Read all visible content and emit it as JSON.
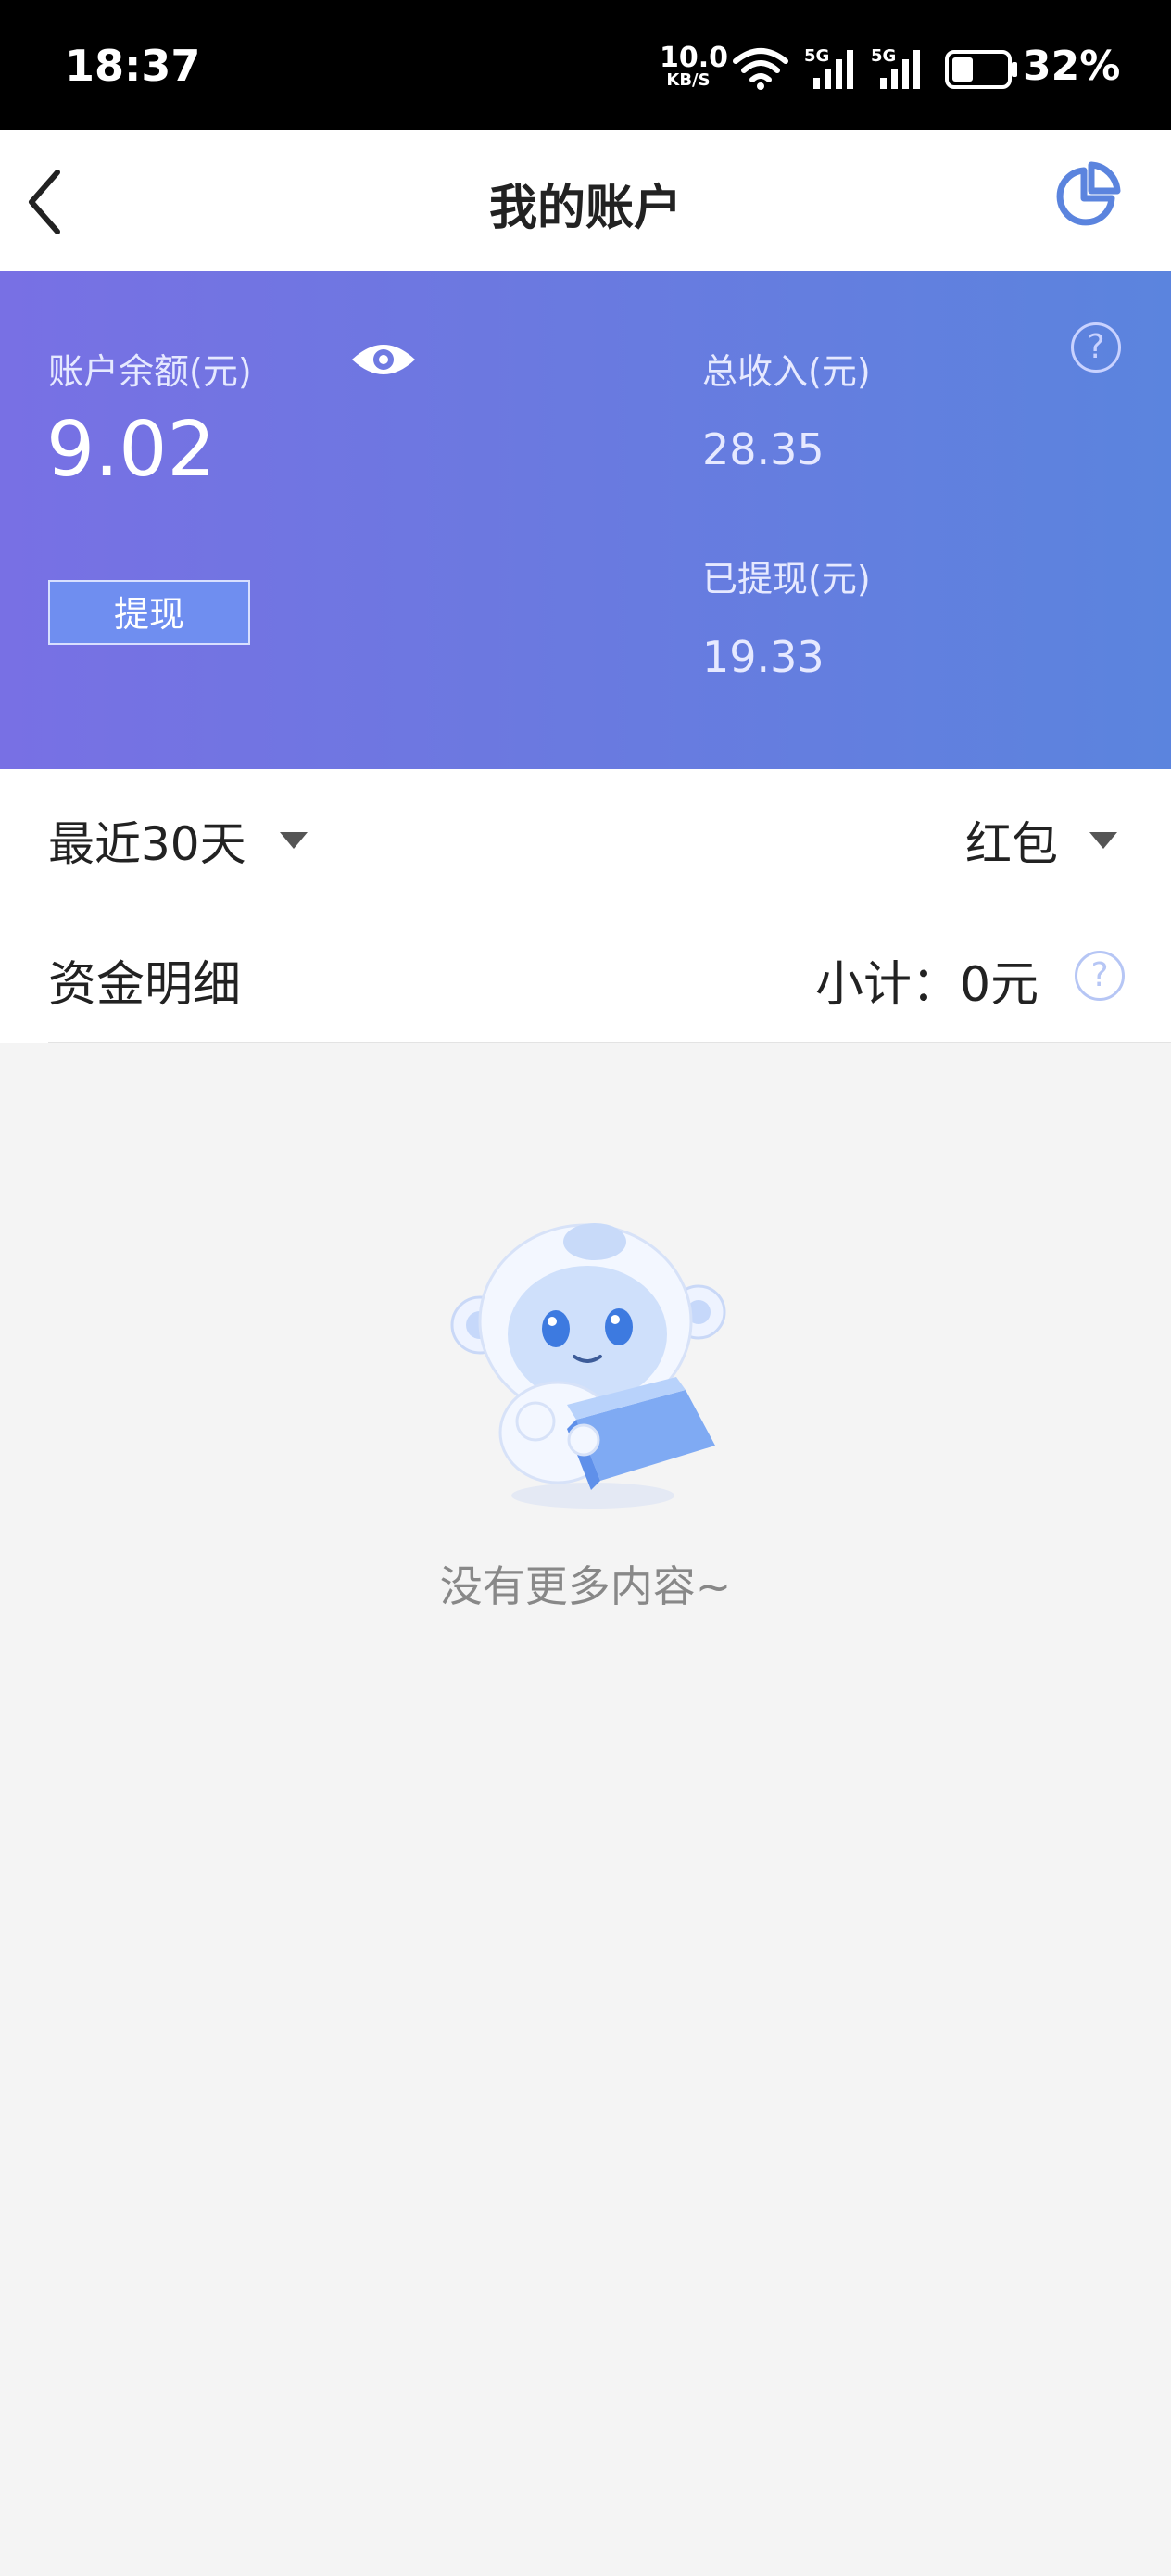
{
  "status_bar": {
    "time": "18:37",
    "net_speed_value": "10.0",
    "net_speed_unit": "KB/S",
    "sim1_label": "5G",
    "sim2_label": "5G",
    "battery_percent": "32%",
    "icons": [
      "wifi-icon",
      "signal-icon",
      "signal-icon",
      "battery-icon"
    ]
  },
  "navbar": {
    "title": "我的账户",
    "back_icon": "chevron-left-icon",
    "stats_icon": "pie-chart-icon",
    "accent": "#5b84de"
  },
  "account": {
    "balance_label": "账户余额(元)",
    "balance_value": "9.02",
    "visibility_icon": "eye-icon",
    "withdraw_label": "提现",
    "total_income_label": "总收入(元)",
    "total_income_value": "28.35",
    "withdrawn_label": "已提现(元)",
    "withdrawn_value": "19.33",
    "help_icon": "help-icon",
    "gradient": [
      "#7870e4",
      "#5b84de"
    ]
  },
  "filters": {
    "period_label": "最近30天",
    "type_label": "红包"
  },
  "details": {
    "title": "资金明细",
    "subtotal_label": "小计：",
    "subtotal_value": "0元",
    "help_icon": "help-icon"
  },
  "empty_state": {
    "illustration": "mascot-holding-box-image",
    "message": "没有更多内容~"
  }
}
